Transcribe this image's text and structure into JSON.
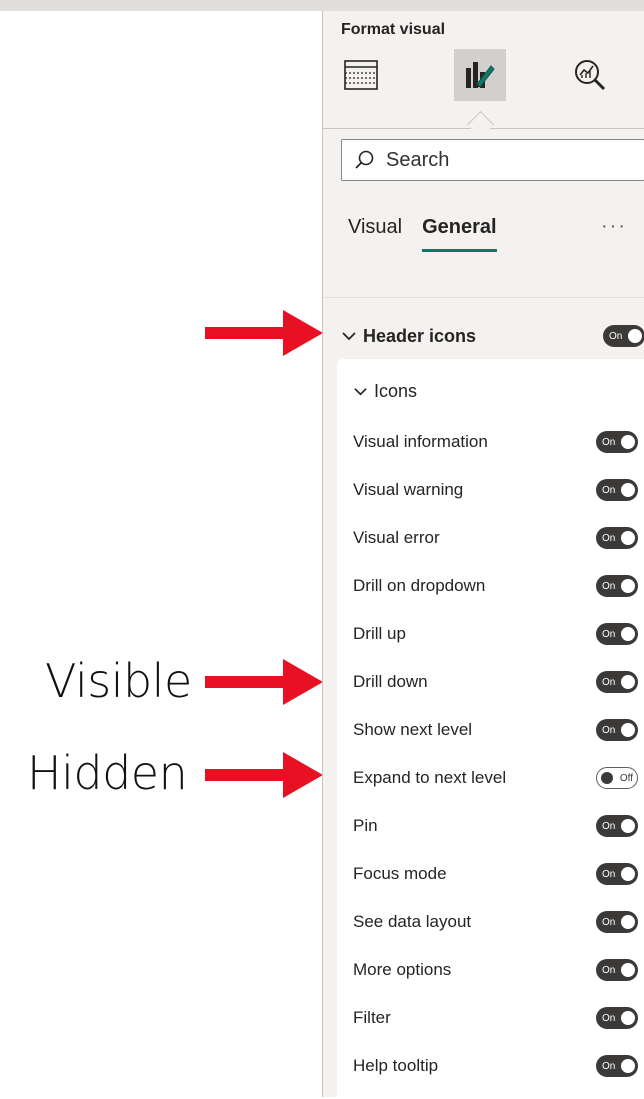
{
  "annotations": {
    "visible_label": "Visible",
    "hidden_label": "Hidden",
    "arrow_color": "#e81123"
  },
  "pane": {
    "title": "Format visual",
    "icons": [
      "build-visual-icon",
      "format-visual-icon",
      "analytics-icon"
    ],
    "active_icon": "format-visual-icon",
    "search": {
      "placeholder": "Search"
    },
    "tabs": [
      {
        "label": "Visual",
        "active": false
      },
      {
        "label": "General",
        "active": true
      }
    ],
    "more_label": "···",
    "accent_color": "#117865",
    "section": {
      "label": "Header icons",
      "toggle": "On",
      "expanded": true
    },
    "subsection": {
      "label": "Icons",
      "expanded": true
    },
    "items": [
      {
        "label": "Visual information",
        "state": "On"
      },
      {
        "label": "Visual warning",
        "state": "On"
      },
      {
        "label": "Visual error",
        "state": "On"
      },
      {
        "label": "Drill on dropdown",
        "state": "On"
      },
      {
        "label": "Drill up",
        "state": "On"
      },
      {
        "label": "Drill down",
        "state": "On"
      },
      {
        "label": "Show next level",
        "state": "On"
      },
      {
        "label": "Expand to next level",
        "state": "Off"
      },
      {
        "label": "Pin",
        "state": "On"
      },
      {
        "label": "Focus mode",
        "state": "On"
      },
      {
        "label": "See data layout",
        "state": "On"
      },
      {
        "label": "More options",
        "state": "On"
      },
      {
        "label": "Filter",
        "state": "On"
      },
      {
        "label": "Help tooltip",
        "state": "On"
      }
    ]
  }
}
